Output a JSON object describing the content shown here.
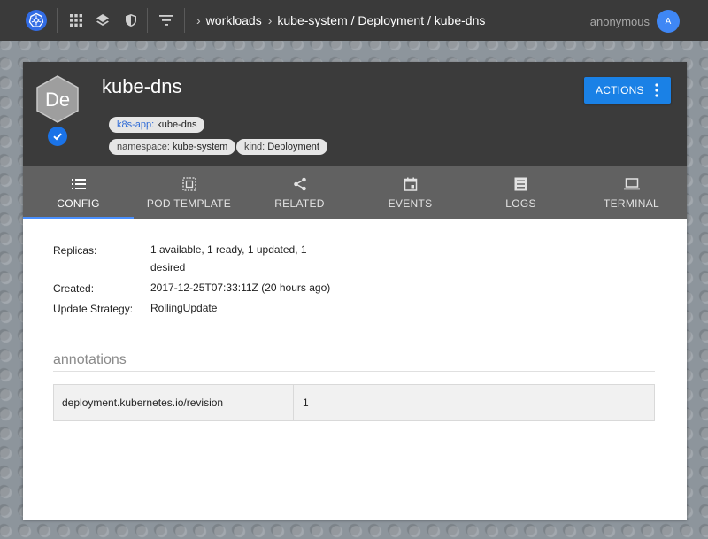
{
  "topbar": {
    "breadcrumbs": [
      "workloads",
      "kube-system / Deployment / kube-dns"
    ],
    "user": "anonymous",
    "avatar_initial": "A"
  },
  "resource": {
    "logo_text": "De",
    "name": "kube-dns",
    "labels": [
      {
        "key": "k8s-app:",
        "value": "kube-dns"
      },
      {
        "key": "namespace:",
        "value": "kube-system"
      },
      {
        "key": "kind:",
        "value": "Deployment"
      }
    ],
    "actions_label": "ACTIONS"
  },
  "tabs": [
    {
      "label": "CONFIG",
      "icon": "list-icon",
      "active": true
    },
    {
      "label": "POD TEMPLATE",
      "icon": "template-icon",
      "active": false
    },
    {
      "label": "RELATED",
      "icon": "share-icon",
      "active": false
    },
    {
      "label": "EVENTS",
      "icon": "calendar-icon",
      "active": false
    },
    {
      "label": "LOGS",
      "icon": "logs-icon",
      "active": false
    },
    {
      "label": "TERMINAL",
      "icon": "laptop-icon",
      "active": false
    }
  ],
  "details": {
    "replicas_label": "Replicas:",
    "replicas_line1": "1 available, 1 ready, 1 updated, 1",
    "replicas_line2": "desired",
    "created_label": "Created:",
    "created_value": "2017-12-25T07:33:11Z (20 hours ago)",
    "strategy_label": "Update Strategy:",
    "strategy_value": "RollingUpdate"
  },
  "annotations": {
    "title": "annotations",
    "rows": [
      {
        "key": "deployment.kubernetes.io/revision",
        "value": "1"
      }
    ]
  },
  "colors": {
    "accent": "#1a81e6",
    "header_bg": "#3b3b3b",
    "tabbar_bg": "#616161",
    "topbar_bg": "#3a3a3a"
  }
}
